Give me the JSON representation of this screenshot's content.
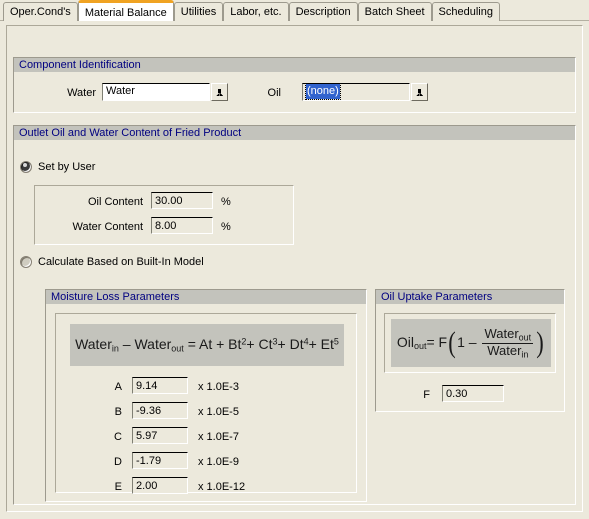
{
  "tabs": [
    {
      "label": "Oper.Cond's",
      "selected": false
    },
    {
      "label": "Material Balance",
      "selected": true
    },
    {
      "label": "Utilities",
      "selected": false
    },
    {
      "label": "Labor, etc.",
      "selected": false
    },
    {
      "label": "Description",
      "selected": false
    },
    {
      "label": "Batch Sheet",
      "selected": false
    },
    {
      "label": "Scheduling",
      "selected": false
    }
  ],
  "component_identification": {
    "title": "Component Identification",
    "water": {
      "label": "Water",
      "value": "Water"
    },
    "oil": {
      "label": "Oil",
      "value": "(none)"
    }
  },
  "outlet": {
    "title": "Outlet Oil and Water Content of Fried Product",
    "mode_set_by_user": {
      "label": "Set by User",
      "selected": true
    },
    "mode_calculate": {
      "label": "Calculate Based on Built-In Model",
      "selected": false
    },
    "oil_content": {
      "label": "Oil Content",
      "value": "30.00",
      "unit": "%"
    },
    "water_content": {
      "label": "Water Content",
      "value": "8.00",
      "unit": "%"
    }
  },
  "moisture_loss": {
    "title": "Moisture Loss Parameters",
    "equation": {
      "lhs_term1": "Water",
      "lhs_term1_sub": "in",
      "minus": "-",
      "lhs_term2": "Water",
      "lhs_term2_sub": "out",
      "equals": "=",
      "rhs": "At + Bt2+ Ct3+ Dt4+ Et5",
      "terms": [
        {
          "coef": "A",
          "var": "t",
          "power": ""
        },
        {
          "coef": "B",
          "var": "t",
          "power": "2"
        },
        {
          "coef": "C",
          "var": "t",
          "power": "3"
        },
        {
          "coef": "D",
          "var": "t",
          "power": "4"
        },
        {
          "coef": "E",
          "var": "t",
          "power": "5"
        }
      ]
    },
    "coefficients": [
      {
        "label": "A",
        "value": "9.14",
        "unit": "x 1.0E-3"
      },
      {
        "label": "B",
        "value": "-9.36",
        "unit": "x 1.0E-5"
      },
      {
        "label": "C",
        "value": "5.97",
        "unit": "x 1.0E-7"
      },
      {
        "label": "D",
        "value": "-1.79",
        "unit": "x 1.0E-9"
      },
      {
        "label": "E",
        "value": "2.00",
        "unit": "x 1.0E-12"
      }
    ]
  },
  "oil_uptake": {
    "title": "Oil Uptake Parameters",
    "equation": {
      "lhs": "Oil",
      "lhs_sub": "out",
      "equals": "=",
      "factor": "F",
      "one": "1",
      "minus": "–",
      "frac_num": "Water",
      "frac_num_sub": "out",
      "frac_den": "Water",
      "frac_den_sub": "in"
    },
    "factor": {
      "label": "F",
      "value": "0.30"
    }
  },
  "colors": {
    "background": "#ECE9DC",
    "group_header": "#C3C3BC",
    "group_header_text": "#000080",
    "tab_selected_accent": "#F0A322",
    "selection_blue": "#3163CE"
  }
}
